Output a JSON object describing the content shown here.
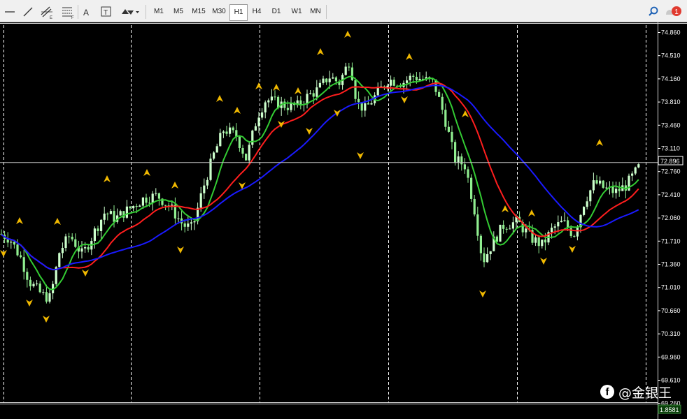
{
  "toolbar": {
    "tools": [
      {
        "name": "crosshair-tool",
        "icon": "horizontal-line-icon"
      },
      {
        "name": "trendline-tool",
        "icon": "trendline-icon"
      },
      {
        "name": "channel-tool",
        "icon": "equidistant-channel-icon",
        "sub": "E"
      },
      {
        "name": "fibonacci-tool",
        "icon": "fibonacci-icon",
        "sub": "F"
      },
      {
        "name": "text-tool",
        "icon": "text-icon",
        "label": "A"
      },
      {
        "name": "text-label-tool",
        "icon": "text-label-icon",
        "label": "T"
      },
      {
        "name": "arrows-tool",
        "icon": "arrows-icon"
      }
    ],
    "timeframes": [
      "M1",
      "M5",
      "M15",
      "M30",
      "H1",
      "H4",
      "D1",
      "W1",
      "MN"
    ],
    "active_timeframe": "H1",
    "notification_count": "1"
  },
  "chart": {
    "price_labels": [
      "74.860",
      "74.510",
      "74.160",
      "73.810",
      "73.460",
      "73.110",
      "72.760",
      "72.410",
      "72.060",
      "71.710",
      "71.360",
      "71.010",
      "70.660",
      "70.310",
      "69.960",
      "69.610",
      "69.260"
    ],
    "price_range": [
      69.26,
      74.86
    ],
    "current_price": "72.896",
    "indicator_value": "1.8581",
    "colors": {
      "background": "#000000",
      "bull_candle": "#ccffcc",
      "bear_candle": "#90ee90",
      "ma_fast": "#33cc33",
      "ma_mid": "#ff1e1e",
      "ma_slow": "#1a1aff",
      "fractal": "#f0b800"
    }
  },
  "watermark": {
    "text": "@金银王",
    "logo": "facebook-icon",
    "logo_glyph": "f"
  }
}
